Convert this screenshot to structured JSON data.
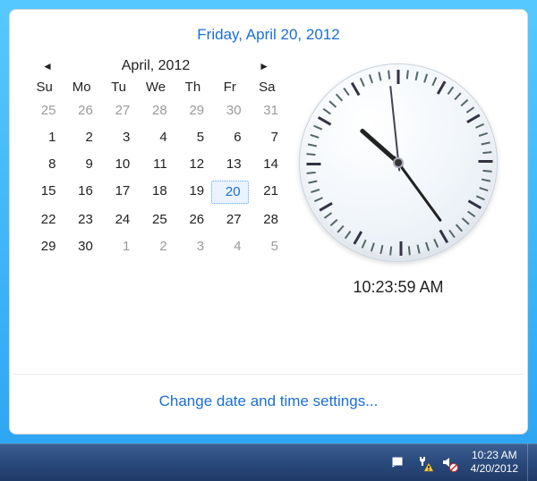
{
  "popup": {
    "title": "Friday, April 20, 2012",
    "calendar": {
      "month_label": "April, 2012",
      "weekdays": [
        "Su",
        "Mo",
        "Tu",
        "We",
        "Th",
        "Fr",
        "Sa"
      ],
      "cells": [
        {
          "n": "25",
          "out": true
        },
        {
          "n": "26",
          "out": true
        },
        {
          "n": "27",
          "out": true
        },
        {
          "n": "28",
          "out": true
        },
        {
          "n": "29",
          "out": true
        },
        {
          "n": "30",
          "out": true
        },
        {
          "n": "31",
          "out": true
        },
        {
          "n": "1"
        },
        {
          "n": "2"
        },
        {
          "n": "3"
        },
        {
          "n": "4"
        },
        {
          "n": "5"
        },
        {
          "n": "6"
        },
        {
          "n": "7"
        },
        {
          "n": "8"
        },
        {
          "n": "9"
        },
        {
          "n": "10"
        },
        {
          "n": "11"
        },
        {
          "n": "12"
        },
        {
          "n": "13"
        },
        {
          "n": "14"
        },
        {
          "n": "15"
        },
        {
          "n": "16"
        },
        {
          "n": "17"
        },
        {
          "n": "18"
        },
        {
          "n": "19"
        },
        {
          "n": "20",
          "sel": true
        },
        {
          "n": "21"
        },
        {
          "n": "22"
        },
        {
          "n": "23"
        },
        {
          "n": "24"
        },
        {
          "n": "25"
        },
        {
          "n": "26"
        },
        {
          "n": "27"
        },
        {
          "n": "28"
        },
        {
          "n": "29"
        },
        {
          "n": "30"
        },
        {
          "n": "1",
          "out": true
        },
        {
          "n": "2",
          "out": true
        },
        {
          "n": "3",
          "out": true
        },
        {
          "n": "4",
          "out": true
        },
        {
          "n": "5",
          "out": true
        }
      ]
    },
    "clock": {
      "digital": "10:23:59 AM",
      "hours": 10,
      "minutes": 23,
      "seconds": 59
    },
    "change_link": "Change date and time settings..."
  },
  "taskbar": {
    "tray_icons": [
      "action-center-icon",
      "power-icon",
      "volume-icon"
    ],
    "time": "10:23 AM",
    "date": "4/20/2012"
  }
}
